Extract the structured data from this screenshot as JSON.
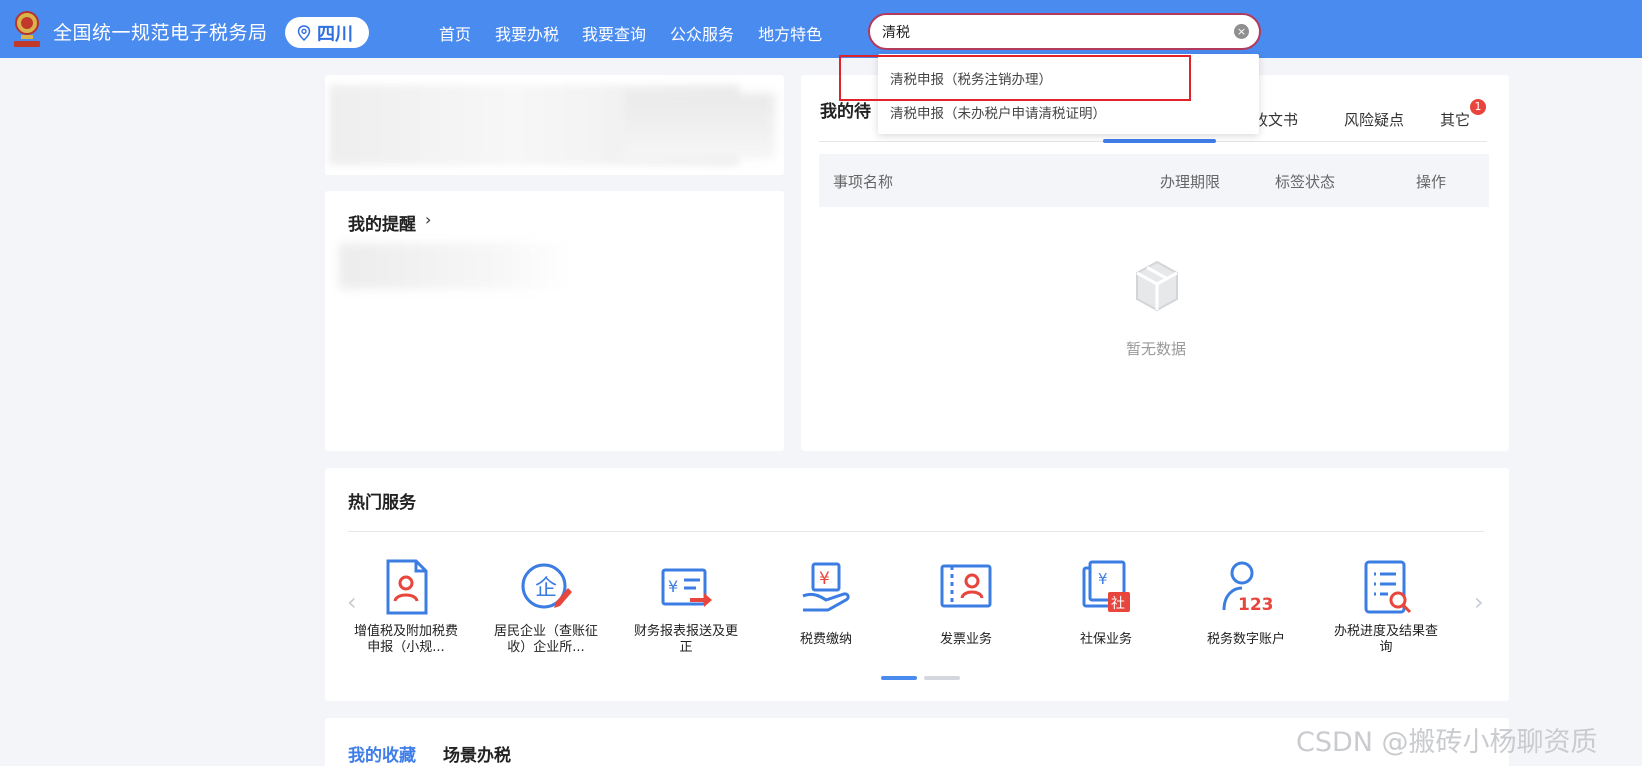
{
  "header": {
    "site_title": "全国统一规范电子税务局",
    "region": "四川",
    "nav": [
      "首页",
      "我要办税",
      "我要查询",
      "公众服务",
      "地方特色"
    ],
    "search": {
      "value": "清税"
    }
  },
  "suggestions": [
    "清税申报（税务注销办理）",
    "清税申报（未办税户申请清税证明）"
  ],
  "reminder": {
    "title": "我的提醒",
    "arrow": "›"
  },
  "todo": {
    "title": "我的待",
    "tabs": [
      "收文书",
      "风险疑点",
      "其它"
    ],
    "badge": "1",
    "columns": [
      "事项名称",
      "办理期限",
      "标签状态",
      "操作"
    ],
    "empty_text": "暂无数据"
  },
  "hot_services": {
    "title": "热门服务",
    "prev": "‹",
    "next": "›",
    "items": [
      {
        "label": "增值税及附加税费申报（小规...",
        "icon": "vat-declare-icon"
      },
      {
        "label": "居民企业（查账征收）企业所...",
        "icon": "enterprise-tax-icon"
      },
      {
        "label": "财务报表报送及更正",
        "icon": "financial-report-icon"
      },
      {
        "label": "税费缴纳",
        "icon": "tax-payment-icon"
      },
      {
        "label": "发票业务",
        "icon": "invoice-icon"
      },
      {
        "label": "社保业务",
        "icon": "social-security-icon"
      },
      {
        "label": "税务数字账户",
        "icon": "digital-account-icon"
      },
      {
        "label": "办税进度及结果查询",
        "icon": "progress-query-icon"
      }
    ],
    "page_count": 2,
    "active_page": 1
  },
  "favorites": {
    "tabs": [
      "我的收藏",
      "场景办税"
    ],
    "active": "我的收藏"
  },
  "watermark": "CSDN @搬砖小杨聊资质",
  "colors": {
    "header": "#4a8bf0",
    "accent": "#3f7ee8",
    "icon_blue": "#3b7de2",
    "icon_red": "#e8453c",
    "highlight_box": "#e0232b"
  }
}
